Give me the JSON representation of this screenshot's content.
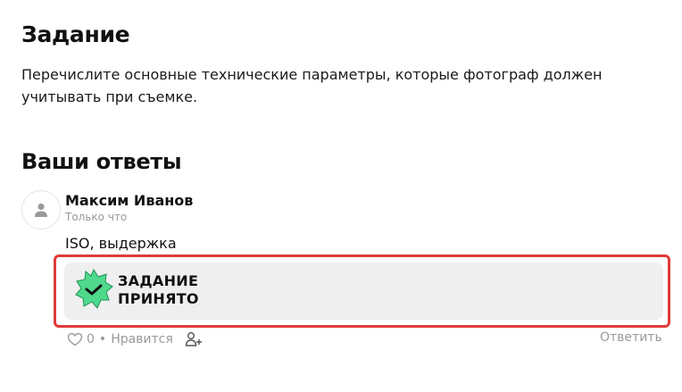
{
  "task": {
    "title": "Задание",
    "text": "Перечислите основные технические параметры, которые фотограф должен учитывать при съемке."
  },
  "answers": {
    "title": "Ваши ответы",
    "items": [
      {
        "author": "Максим Иванов",
        "time": "Только что",
        "text": "ISO, выдержка",
        "status_line1": "ЗАДАНИЕ",
        "status_line2": "ПРИНЯТО",
        "likes": "0",
        "separator": "•",
        "like_label": "Нравится",
        "reply_label": "Ответить"
      }
    ]
  },
  "colors": {
    "badge_green": "#4fd98c",
    "highlight_red": "#e03a3a",
    "muted": "#9a9a9a"
  },
  "icons": [
    "user-icon",
    "badge-check-icon",
    "heart-icon",
    "add-friend-icon"
  ]
}
